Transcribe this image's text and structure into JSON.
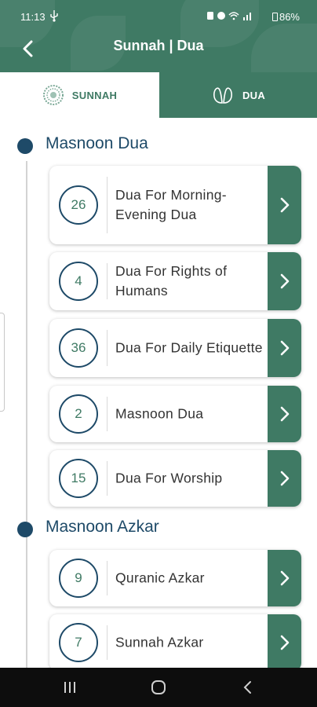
{
  "status_bar": {
    "time": "11:13",
    "battery": "86%"
  },
  "app_bar": {
    "title": "Sunnah | Dua"
  },
  "tabs": [
    {
      "label": "SUNNAH",
      "icon": "sunnah-icon",
      "active": false
    },
    {
      "label": "DUA",
      "icon": "dua-hands-icon",
      "active": true
    }
  ],
  "sections": [
    {
      "title": "Masnoon Dua",
      "items": [
        {
          "count": "26",
          "label": "Dua For Morning-Evening Dua"
        },
        {
          "count": "4",
          "label": "Dua For Rights of Humans"
        },
        {
          "count": "36",
          "label": "Dua For Daily Etiquette"
        },
        {
          "count": "2",
          "label": "Masnoon Dua"
        },
        {
          "count": "15",
          "label": "Dua For Worship"
        }
      ]
    },
    {
      "title": "Masnoon Azkar",
      "items": [
        {
          "count": "9",
          "label": "Quranic Azkar"
        },
        {
          "count": "7",
          "label": "Sunnah Azkar"
        }
      ]
    }
  ],
  "colors": {
    "primary_green": "#3f7a64",
    "navy": "#1e4a68",
    "text": "#333333"
  }
}
